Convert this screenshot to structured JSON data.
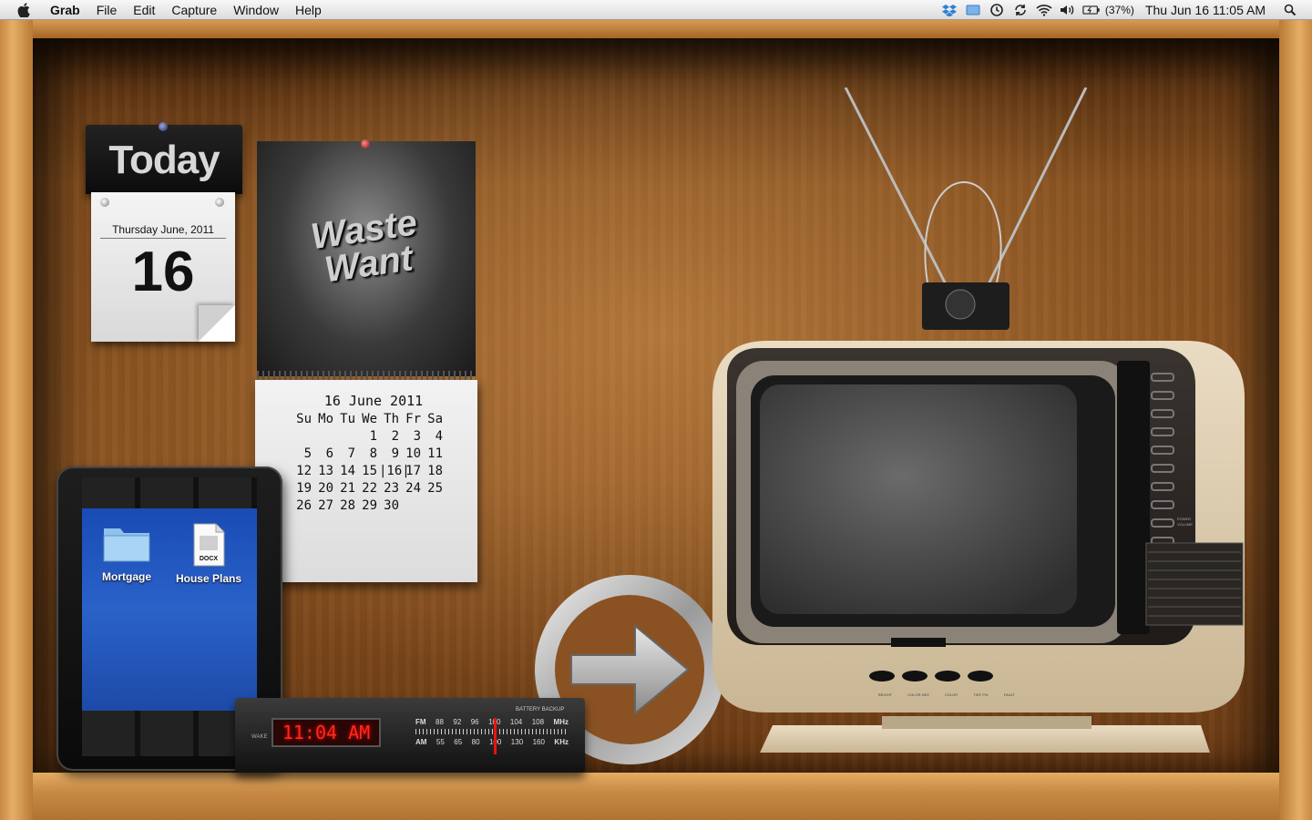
{
  "menubar": {
    "app_name": "Grab",
    "menus": [
      "File",
      "Edit",
      "Capture",
      "Window",
      "Help"
    ],
    "battery_percent": "(37%)",
    "clock": "Thu Jun 16  11:05 AM",
    "icons": [
      "apple-logo-icon",
      "dropbox-icon",
      "finder-icon",
      "time-machine-icon",
      "sync-icon",
      "wifi-icon",
      "volume-icon",
      "battery-icon",
      "spotlight-icon"
    ]
  },
  "today_widget": {
    "title": "Today",
    "date_line": "Thursday June, 2011",
    "day": "16"
  },
  "wall_calendar": {
    "poster_text": "Waste Want",
    "header": "16 June 2011",
    "weekdays": [
      "Su",
      "Mo",
      "Tu",
      "We",
      "Th",
      "Fr",
      "Sa"
    ],
    "weeks": [
      [
        "",
        "",
        "",
        "1",
        "2",
        "3",
        "4"
      ],
      [
        "5",
        "6",
        "7",
        "8",
        "9",
        "10",
        "11"
      ],
      [
        "12",
        "13",
        "14",
        "15",
        "|16|",
        "17",
        "18"
      ],
      [
        "19",
        "20",
        "21",
        "22",
        "23",
        "24",
        "25"
      ],
      [
        "26",
        "27",
        "28",
        "29",
        "30",
        "",
        ""
      ]
    ]
  },
  "desktop_items": [
    {
      "label": "Mortgage",
      "icon": "folder-icon"
    },
    {
      "label": "House Plans",
      "icon": "docx-file-icon",
      "badge": "DOCX"
    }
  ],
  "radio": {
    "time": "11:04 AM",
    "wake_label": "WAKE",
    "battery_label": "BATTERY BACKUP",
    "fm_label": "FM",
    "fm_values": [
      "88",
      "92",
      "96",
      "100",
      "104",
      "108"
    ],
    "fm_unit": "MHz",
    "am_label": "AM",
    "am_values": [
      "55",
      "65",
      "80",
      "100",
      "130",
      "160"
    ],
    "am_unit": "KHz"
  },
  "tv": {
    "labels": [
      "BRIGHT",
      "COLOR HEX",
      "COLOR",
      "TINT PIX",
      "FAULT"
    ],
    "side_labels": [
      "POWER",
      "VOLUME"
    ]
  },
  "colors": {
    "wood_light": "#e5ae67",
    "wood_dark": "#4e2a0e",
    "desktop_blue": "#2a62c9",
    "lcd_red": "#ff2a1a"
  }
}
